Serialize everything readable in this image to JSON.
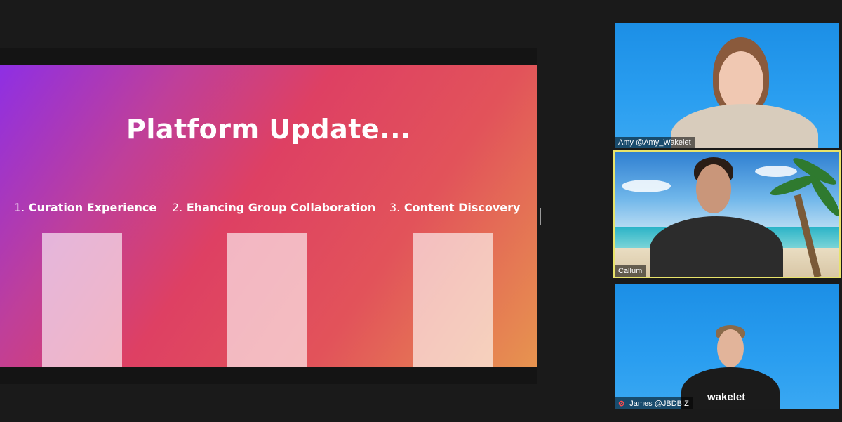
{
  "slide": {
    "title": "Platform Update...",
    "items": [
      {
        "num": "1.",
        "label": "Curation Experience"
      },
      {
        "num": "2.",
        "label": "Ehancing Group Collaboration"
      },
      {
        "num": "3.",
        "label": "Content Discovery"
      }
    ]
  },
  "participants": [
    {
      "name": "Amy @Amy_Wakelet",
      "muted": false,
      "active": false
    },
    {
      "name": "Callum",
      "muted": false,
      "active": true
    },
    {
      "name": "James @JBDBIZ",
      "muted": true,
      "active": false
    }
  ],
  "shirt_logo": "wakelet",
  "colors": {
    "active_speaker_border": "#e8e36a",
    "muted_icon": "#ff4d4d",
    "tile_background": "#2a9ef0"
  }
}
